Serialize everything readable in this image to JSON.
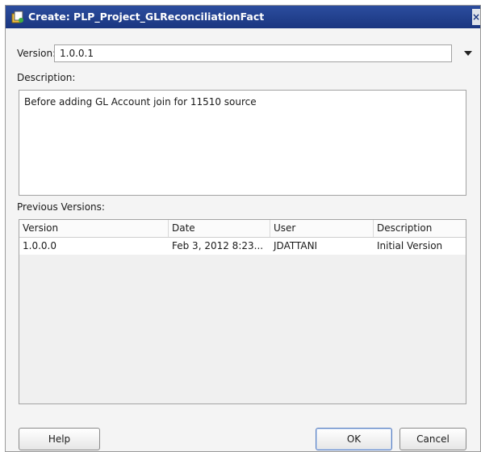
{
  "window": {
    "title": "Create: PLP_Project_GLReconciliationFact",
    "close_glyph": "×"
  },
  "form": {
    "version_label": "Version:",
    "version_value": "1.0.0.1",
    "description_label": "Description:",
    "description_value": "Before adding GL Account join for 11510 source",
    "previous_versions_label": "Previous Versions:"
  },
  "table": {
    "columns": [
      "Version",
      "Date",
      "User",
      "Description"
    ],
    "rows": [
      [
        "1.0.0.0",
        "Feb 3, 2012 8:23...",
        "JDATTANI",
        "Initial Version"
      ]
    ]
  },
  "buttons": {
    "help": "Help",
    "ok": "OK",
    "cancel": "Cancel"
  },
  "icons": {
    "title": "create-version-icon",
    "dropdown": "triangle-down-icon"
  }
}
